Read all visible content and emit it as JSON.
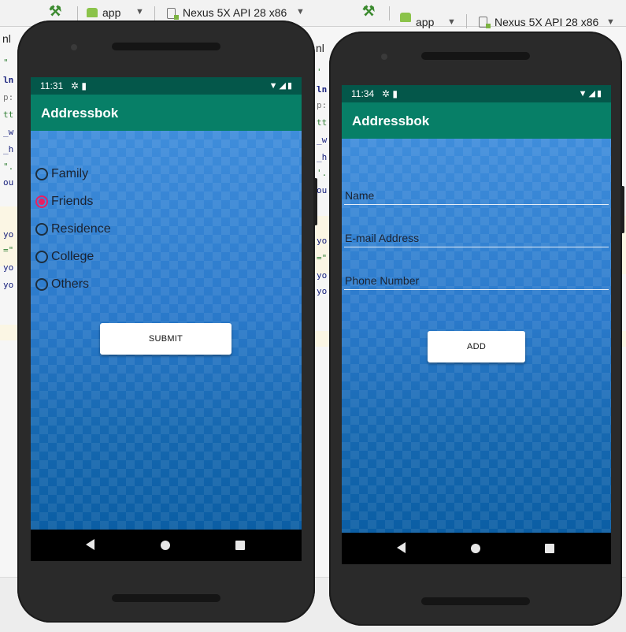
{
  "ide": {
    "run_config": "app",
    "device": "Nexus 5X API 28 x86",
    "left_code": [
      "nl",
      "\"",
      "ln",
      "p:",
      "tt",
      "_w",
      "_h",
      "\".",
      "ou",
      "yo",
      "=\"",
      "yo",
      "yo"
    ],
    "right_code": [
      "nl",
      "'",
      "ln",
      "p:",
      "tt",
      "_w",
      "_h",
      "'.",
      "ou",
      "yo",
      "=\"",
      "yo",
      "yo"
    ]
  },
  "screen_one": {
    "status_time": "11:31",
    "app_title": "Addressbok",
    "radio_options": [
      {
        "label": "Family",
        "checked": false
      },
      {
        "label": "Friends",
        "checked": true
      },
      {
        "label": "Residence",
        "checked": false
      },
      {
        "label": "College",
        "checked": false
      },
      {
        "label": "Others",
        "checked": false
      }
    ],
    "submit_label": "SUBMIT"
  },
  "screen_two": {
    "status_time": "11:34",
    "app_title": "Addressbok",
    "fields": [
      {
        "placeholder": "Name"
      },
      {
        "placeholder": "E-mail Address"
      },
      {
        "placeholder": "Phone Number"
      }
    ],
    "add_label": "ADD"
  },
  "colors": {
    "status_bar": "#04574a",
    "app_bar": "#077f67",
    "radio_checked": "#e91e63",
    "content_blue": "#2b7acb"
  },
  "icons": {
    "status_left": [
      "gear-icon",
      "sd-card-icon"
    ],
    "status_right": [
      "wifi-icon",
      "signal-icon",
      "battery-icon"
    ],
    "nav": [
      "back-icon",
      "home-icon",
      "recents-icon"
    ],
    "toolbar": [
      "hammer-icon",
      "android-icon",
      "device-icon",
      "dropdown-arrow-icon"
    ]
  }
}
